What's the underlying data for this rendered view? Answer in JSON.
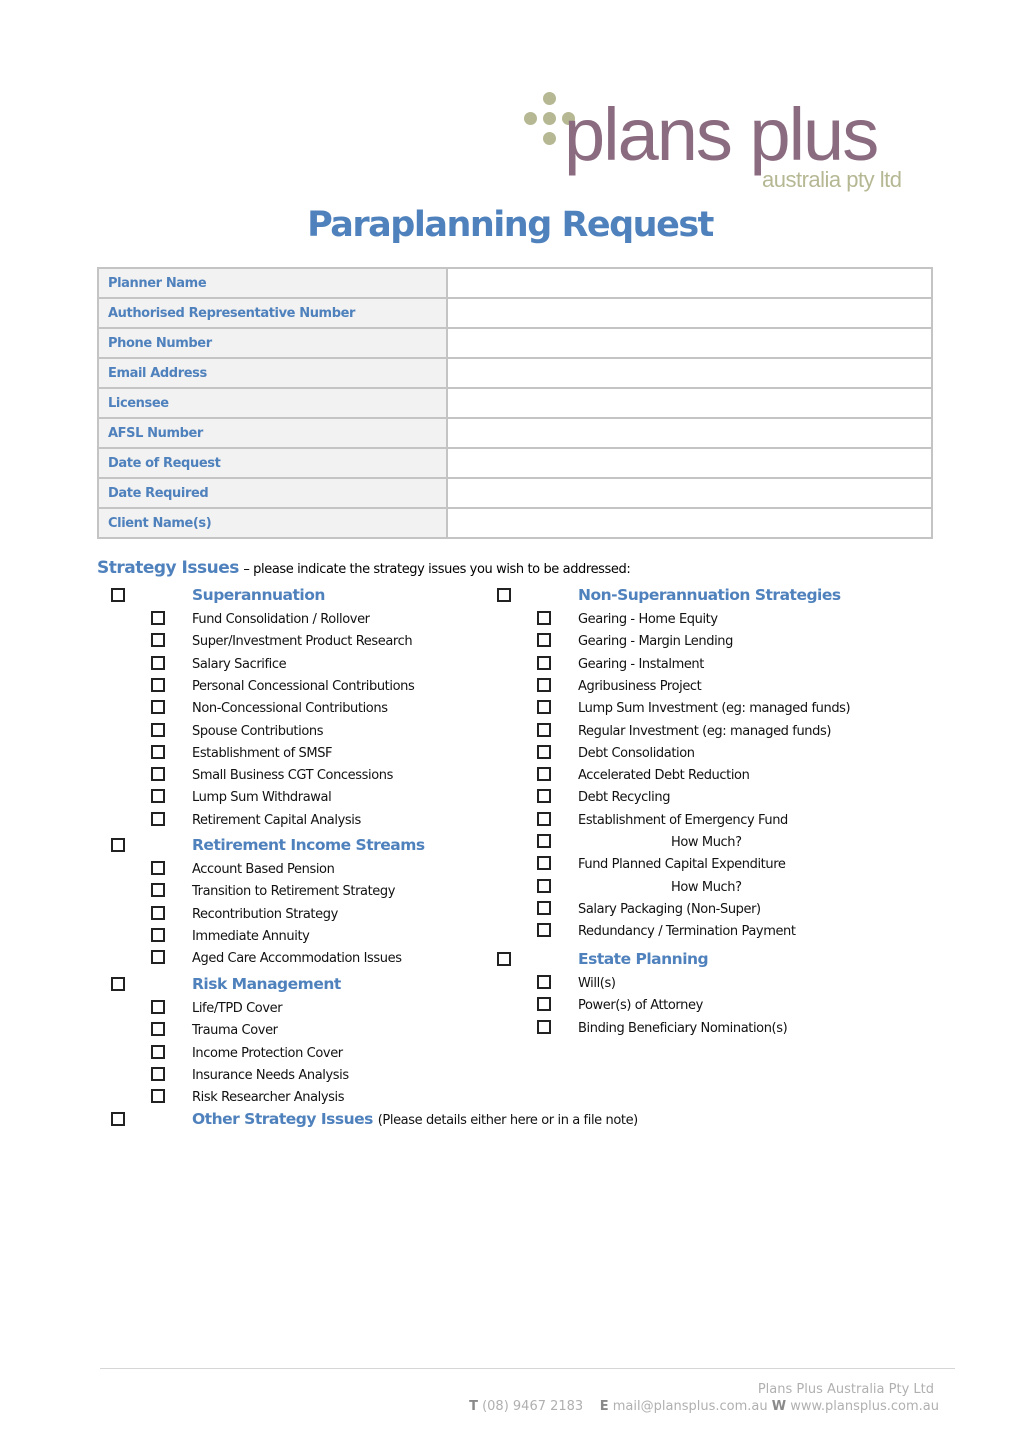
{
  "brand": {
    "logo_main": "plans plus",
    "logo_sub": "australia pty ltd",
    "main_color": "#8b6b80",
    "accent_color": "#b6b894"
  },
  "title": "Paraplanning Request",
  "form_fields": [
    {
      "label": "Planner Name",
      "value": ""
    },
    {
      "label": "Authorised Representative Number",
      "value": ""
    },
    {
      "label": "Phone Number",
      "value": ""
    },
    {
      "label": "Email Address",
      "value": ""
    },
    {
      "label": "Licensee",
      "value": ""
    },
    {
      "label": "AFSL Number",
      "value": ""
    },
    {
      "label": "Date of Request",
      "value": ""
    },
    {
      "label": "Date Required",
      "value": ""
    },
    {
      "label": "Client Name(s)",
      "value": ""
    }
  ],
  "strategy": {
    "heading": "Strategy Issues",
    "subheading": "– please indicate the strategy issues you wish to be addressed:",
    "left_column": [
      {
        "category": "Superannuation",
        "checked": false,
        "items": [
          "Fund Consolidation / Rollover",
          "Super/Investment Product Research",
          "Salary Sacrifice",
          "Personal Concessional Contributions",
          "Non-Concessional Contributions",
          "Spouse Contributions",
          "Establishment of SMSF",
          "Small Business CGT Concessions",
          "Lump Sum Withdrawal",
          "Retirement Capital Analysis"
        ]
      },
      {
        "category": "Retirement Income Streams",
        "checked": false,
        "items": [
          "Account Based Pension",
          "Transition to Retirement Strategy",
          "Recontribution Strategy",
          "Immediate Annuity",
          "Aged Care Accommodation Issues"
        ]
      },
      {
        "category": "Risk Management",
        "checked": false,
        "items": [
          "Life/TPD Cover",
          "Trauma Cover",
          "Income Protection Cover",
          "Insurance Needs Analysis",
          "Risk Researcher Analysis"
        ]
      },
      {
        "category": "Other Strategy Issues",
        "note": "(Please details either here or in a file note)",
        "checked": false,
        "items": []
      }
    ],
    "right_column": [
      {
        "category": "Non-Superannuation Strategies",
        "checked": false,
        "items": [
          "Gearing - Home Equity",
          "Gearing - Margin Lending",
          "Gearing - Instalment",
          "Agribusiness Project",
          "Lump Sum Investment (eg: managed funds)",
          "Regular Investment (eg: managed funds)",
          "Debt Consolidation",
          "Accelerated Debt Reduction",
          "Debt Recycling",
          "Establishment of Emergency Fund",
          "How Much?",
          "Fund Planned Capital Expenditure",
          "How Much?",
          "Salary Packaging (Non-Super)",
          "Redundancy / Termination Payment"
        ]
      },
      {
        "category": "Estate Planning",
        "checked": false,
        "items": [
          "Will(s)",
          "Power(s) of Attorney",
          "Binding Beneficiary Nomination(s)"
        ]
      }
    ]
  },
  "footer": {
    "company": "Plans Plus Australia Pty Ltd",
    "phone_label": "T",
    "phone": "(08) 9467 2183",
    "email_label": "E",
    "email": "mail@plansplus.com.au",
    "web_label": "W",
    "web": "www.plansplus.com.au"
  }
}
